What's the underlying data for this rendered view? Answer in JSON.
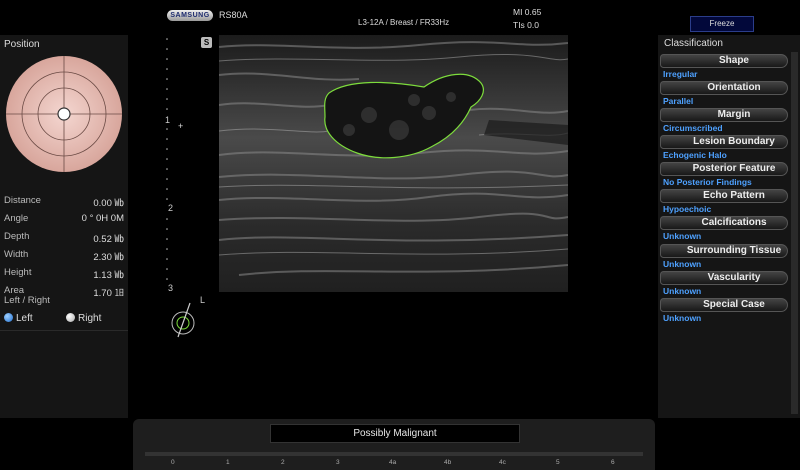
{
  "header": {
    "brand": "SAMSUNG",
    "model": "RS80A",
    "probe_info": "L3-12A / Breast / FR33Hz",
    "mi_line": "MI  0.65",
    "tis_line": "TIs  0.0",
    "freeze_label": "Freeze"
  },
  "left_panel": {
    "title": "Position",
    "measurements": [
      {
        "label": "Distance",
        "value": "0.00 ㏝"
      },
      {
        "label": "Angle",
        "value": "0 ° 0H 0M"
      },
      {
        "label": "Depth",
        "value": "0.52 ㏝"
      },
      {
        "label": "Width",
        "value": "2.30 ㏝"
      },
      {
        "label": "Height",
        "value": "1.13 ㏝"
      },
      {
        "label": "Area",
        "value": "1.70 ㏠"
      }
    ],
    "left_right_label": "Left / Right",
    "left_option": "Left",
    "right_option": "Right",
    "selected_side": "Left"
  },
  "image": {
    "scale_labels": [
      "1",
      "2",
      "3"
    ],
    "s_badge": "S",
    "l_marker": "L"
  },
  "right_panel": {
    "title": "Classification",
    "items": [
      {
        "header": "Shape",
        "value": "Irregular"
      },
      {
        "header": "Orientation",
        "value": "Parallel"
      },
      {
        "header": "Margin",
        "value": "Circumscribed"
      },
      {
        "header": "Lesion Boundary",
        "value": "Echogenic Halo"
      },
      {
        "header": "Posterior Feature",
        "value": "No Posterior Findings"
      },
      {
        "header": "Echo Pattern",
        "value": "Hypoechoic"
      },
      {
        "header": "Calcifications",
        "value": "Unknown"
      },
      {
        "header": "Surrounding Tissue",
        "value": "Unknown"
      },
      {
        "header": "Vascularity",
        "value": "Unknown"
      },
      {
        "header": "Special Case",
        "value": "Unknown"
      }
    ]
  },
  "bottom": {
    "result": "Possibly Malignant",
    "scale_ticks": [
      "0",
      "1",
      "2",
      "3",
      "4a",
      "4b",
      "4c",
      "5",
      "6"
    ]
  },
  "colors": {
    "accent_blue": "#4ea1ff",
    "lesion_outline": "#7ddc3c",
    "position_disc": "#e8b8b0"
  }
}
